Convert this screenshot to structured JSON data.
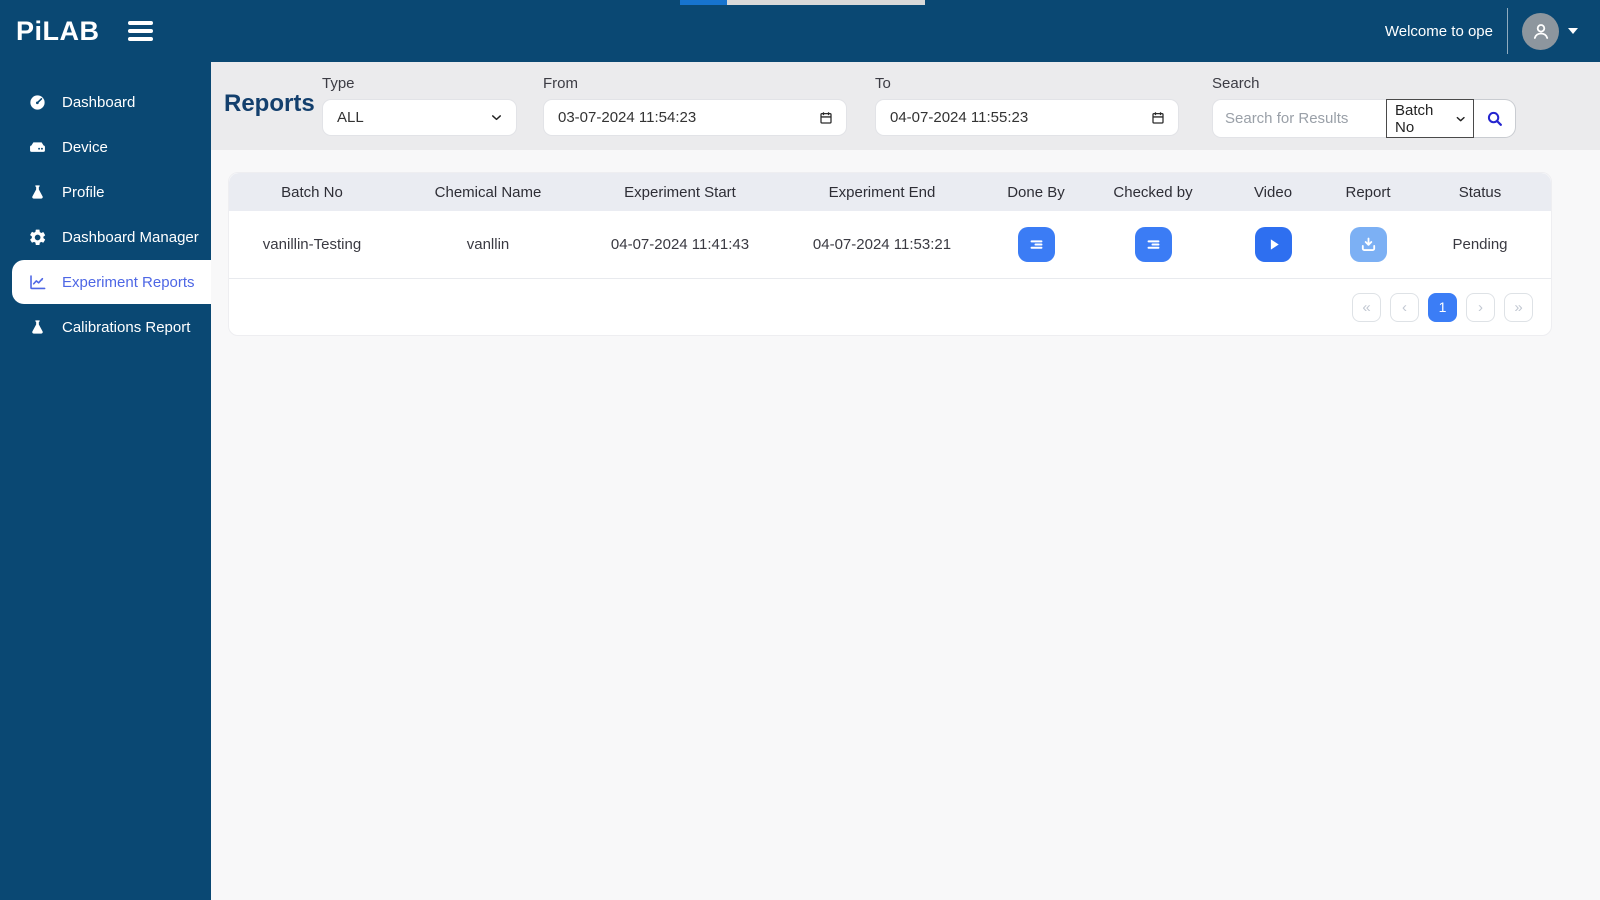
{
  "colors": {
    "navy": "#0a4873",
    "sidebar_active_blue": "#4e67e5",
    "action_button_blue": "#3b7cf5",
    "video_button_blue": "#2e6ff0",
    "report_button_light_blue": "#7cb0f4",
    "search_icon_blue": "#2525cf",
    "pagination_active_blue": "#3b7df6",
    "progress_bar_blue": "#1774cf",
    "progress_bar_track": "#d9d9d9",
    "filter_band_gray": "#ebebed",
    "table_header_gray": "#eaecf2"
  },
  "navbar": {
    "brand": "PiLAB",
    "welcome_text": "Welcome to ope"
  },
  "sidebar": {
    "items": [
      {
        "label": "Dashboard",
        "icon": "gauge-icon",
        "active": false
      },
      {
        "label": "Device",
        "icon": "device-icon",
        "active": false
      },
      {
        "label": "Profile",
        "icon": "flask-icon",
        "active": false
      },
      {
        "label": "Dashboard Manager",
        "icon": "gear-icon",
        "active": false
      },
      {
        "label": "Experiment Reports",
        "icon": "chart-line-icon",
        "active": true
      },
      {
        "label": "Calibrations Report",
        "icon": "flask-icon",
        "active": false
      }
    ]
  },
  "filters": {
    "title": "Reports",
    "type_label": "Type",
    "type_value": "ALL",
    "from_label": "From",
    "from_value": "03-07-2024 11:54:23",
    "to_label": "To",
    "to_value": "04-07-2024 11:55:23",
    "search_label": "Search",
    "search_placeholder": "Search for Results",
    "search_category": "Batch No"
  },
  "table": {
    "headers": [
      "Batch No",
      "Chemical Name",
      "Experiment Start",
      "Experiment End",
      "Done By",
      "Checked by",
      "Video",
      "Report",
      "Status"
    ],
    "rows": [
      {
        "batch_no": "vanillin-Testing",
        "chemical_name": "vanllin",
        "experiment_start": "04-07-2024 11:41:43",
        "experiment_end": "04-07-2024 11:53:21",
        "status": "Pending"
      }
    ]
  },
  "pagination": {
    "first_label": "«",
    "prev_label": "‹",
    "page": "1",
    "next_label": "›",
    "last_label": "»"
  }
}
